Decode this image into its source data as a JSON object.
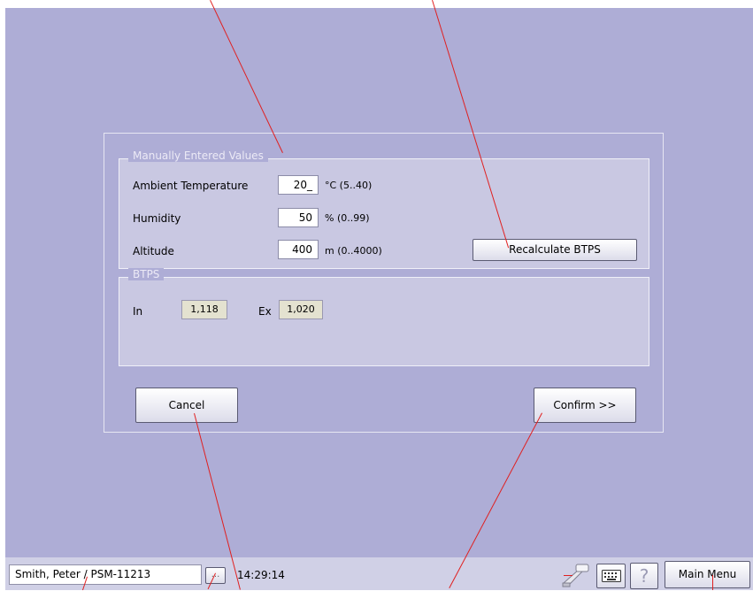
{
  "manual": {
    "group_title": "Manually Entered Values",
    "ambient_label": "Ambient Temperature",
    "ambient_value": "20_",
    "ambient_unit": "°C (5..40)",
    "humidity_label": "Humidity",
    "humidity_value": "50",
    "humidity_unit": "% (0..99)",
    "altitude_label": "Altitude",
    "altitude_value": "400",
    "altitude_unit": "m (0..4000)",
    "recalc_label": "Recalculate BTPS"
  },
  "btps": {
    "group_title": "BTPS",
    "in_label": "In",
    "in_value": "1,118",
    "ex_label": "Ex",
    "ex_value": "1,020"
  },
  "buttons": {
    "cancel_label": "Cancel",
    "confirm_label": "Confirm >>"
  },
  "statusbar": {
    "patient": "Smith, Peter / PSM-11213",
    "dots": "...",
    "time": "14:29:14",
    "help": "?",
    "main_menu_label": "Main Menu"
  },
  "icons": {
    "device": "sensor-device-icon",
    "keyboard": "keyboard-icon",
    "help": "help-icon"
  },
  "colors": {
    "background": "#aeadd6",
    "annotation_line": "#e02020"
  }
}
